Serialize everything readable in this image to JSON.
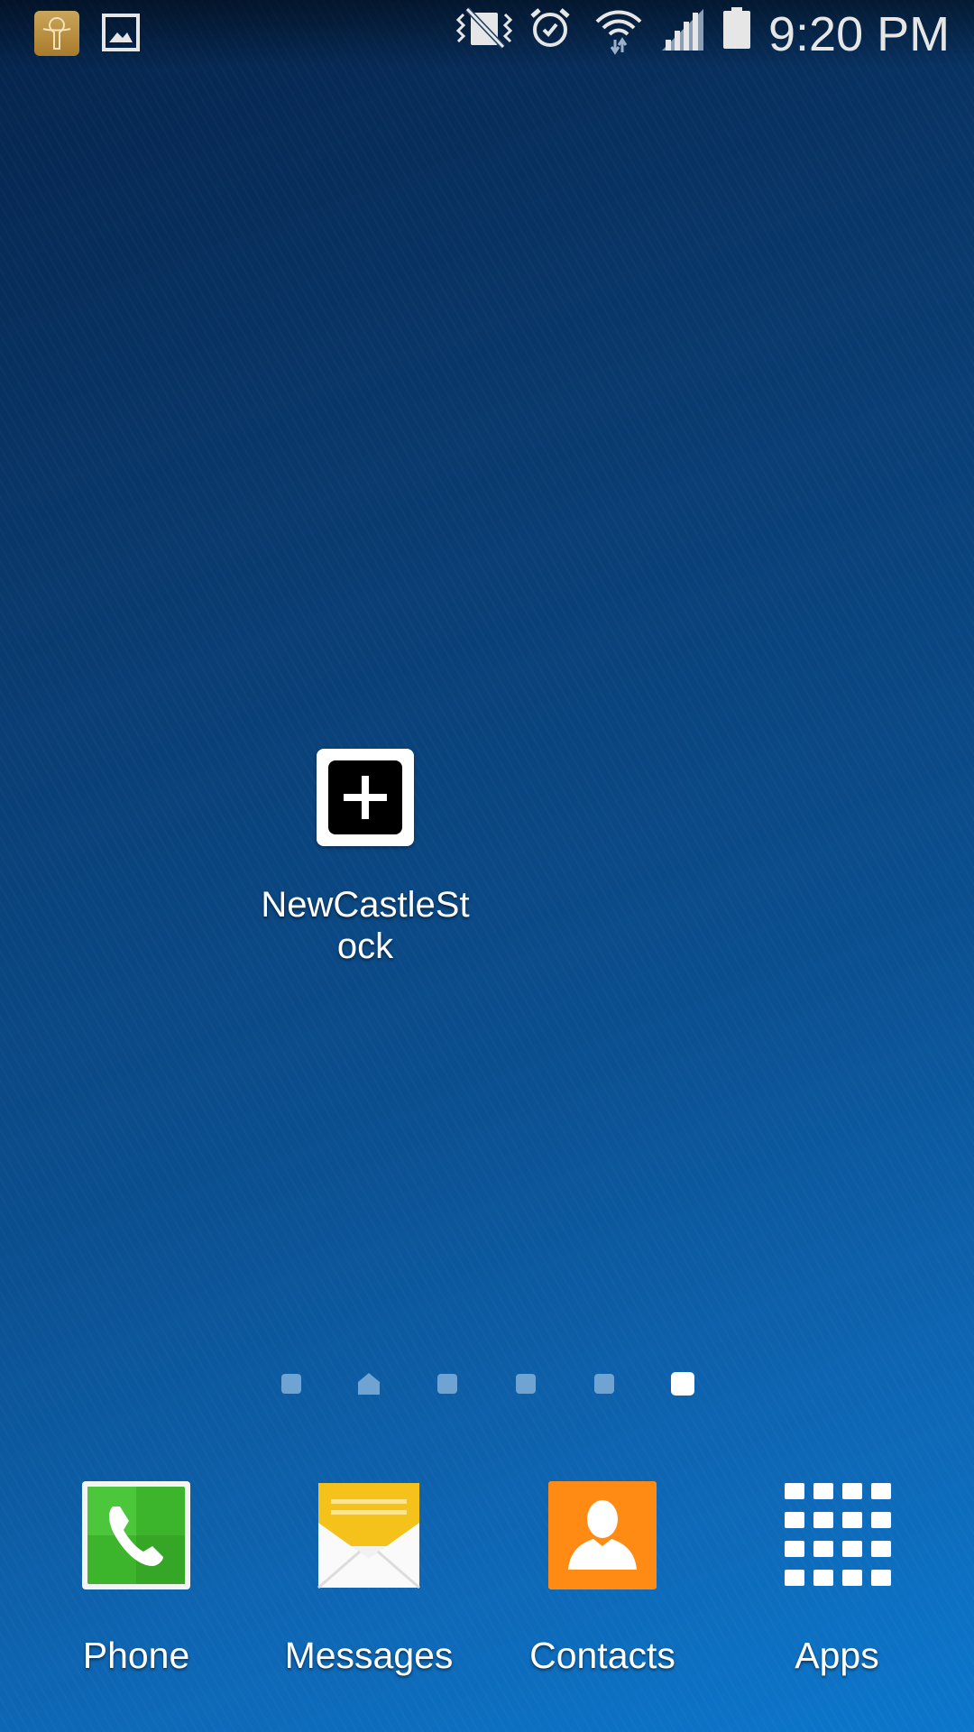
{
  "status_bar": {
    "time": "9:20 PM",
    "notification_icons": [
      "app-notification-icon",
      "gallery-icon"
    ],
    "system_icons": [
      "vibrate-mute-icon",
      "alarm-icon",
      "wifi-icon",
      "signal-icon",
      "battery-icon"
    ]
  },
  "home": {
    "shortcut": {
      "label": "NewCastleStock",
      "icon": "plus-icon"
    }
  },
  "page_indicator": {
    "pages": 6,
    "home_page": 2,
    "active_page": 6
  },
  "dock": {
    "items": [
      {
        "label": "Phone",
        "icon": "phone-icon",
        "color": "#3cb52c"
      },
      {
        "label": "Messages",
        "icon": "messages-icon",
        "color": "#f2bc12"
      },
      {
        "label": "Contacts",
        "icon": "contacts-icon",
        "color": "#ff8a14"
      },
      {
        "label": "Apps",
        "icon": "apps-grid-icon",
        "color": "#ffffff"
      }
    ]
  },
  "colors": {
    "wallpaper_top": "#05234a",
    "wallpaper_bottom": "#0c77cc"
  }
}
